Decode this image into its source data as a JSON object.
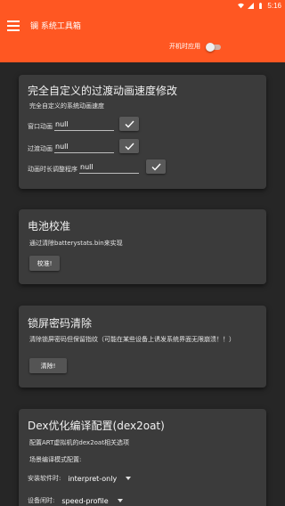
{
  "status_bar": {
    "time": "5:16"
  },
  "app": {
    "title": "镧 系统工具箱"
  },
  "boot": {
    "label": "开机时应用",
    "enabled": false
  },
  "colors": {
    "accent": "#ff5722",
    "background": "#262626",
    "card": "#3b3b3b"
  },
  "animation_card": {
    "title": "完全自定义的过渡动画速度修改",
    "desc": "完全自定义的系统动画速度",
    "fields": [
      {
        "label": "窗口动画",
        "value": "null"
      },
      {
        "label": "过渡动画",
        "value": "null"
      },
      {
        "label": "动画时长调整程序",
        "value": "null"
      }
    ]
  },
  "battery_card": {
    "title": "电池校准",
    "desc": "通过清除batterystats.bin来实现",
    "button": "校准!"
  },
  "lockscreen_card": {
    "title": "锁屏密码清除",
    "desc": "清除锁屏密码但保留指纹（可能在某些设备上诱发系统界面无限崩溃！！）",
    "button": "清除!"
  },
  "dex_card": {
    "title": "Dex优化编译配置(dex2oat)",
    "desc": "配置ART虚拟机的dex2oat相关选项",
    "section_label": "场景编译模式配置:",
    "rows": [
      {
        "label": "安装软件时:",
        "value": "interpret-only"
      },
      {
        "label": "设备闲时:",
        "value": "speed-profile"
      }
    ]
  }
}
